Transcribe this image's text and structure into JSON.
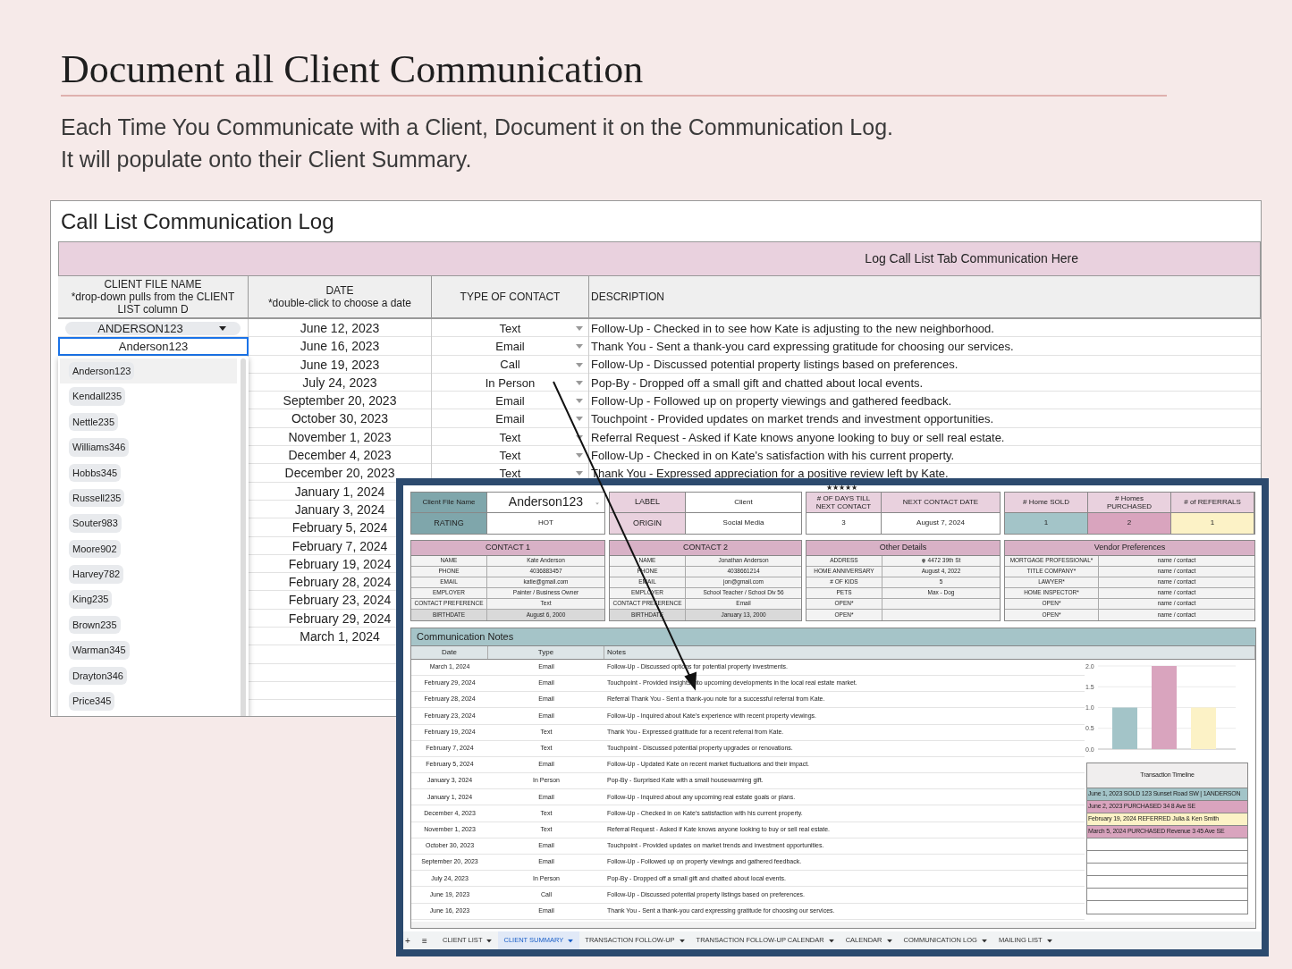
{
  "heading": {
    "title": "Document all Client Communication",
    "lines": [
      "Each Time You Communicate with a Client, Document it on the Communication Log.",
      "It will populate onto their Client Summary."
    ]
  },
  "log": {
    "title": "Call List Communication Log",
    "banner": "Log Call List Tab Communication Here",
    "columns": [
      {
        "title": "CLIENT FILE NAME",
        "note": "*drop-down pulls from the CLIENT LIST column D"
      },
      {
        "title": "DATE",
        "note": "*double-click to choose a date"
      },
      {
        "title": "TYPE OF CONTACT"
      },
      {
        "title": "DESCRIPTION"
      }
    ],
    "client_chip": "ANDERSON123",
    "client_editor": "Anderson123",
    "dropdown": [
      {
        "label": "Anderson123",
        "selected": true
      },
      {
        "label": "Kendall235",
        "selected": false
      },
      {
        "label": "Nettle235",
        "selected": false
      },
      {
        "label": "Williams346",
        "selected": false
      },
      {
        "label": "Hobbs345",
        "selected": false
      },
      {
        "label": "Russell235",
        "selected": false
      },
      {
        "label": "Souter983",
        "selected": false
      },
      {
        "label": "Moore902",
        "selected": false
      },
      {
        "label": "Harvey782",
        "selected": false
      },
      {
        "label": "King235",
        "selected": false
      },
      {
        "label": "Brown235",
        "selected": false
      },
      {
        "label": "Warman345",
        "selected": false
      },
      {
        "label": "Drayton346",
        "selected": false
      },
      {
        "label": "Price345",
        "selected": false
      }
    ],
    "rows": [
      {
        "date": "June 12, 2023",
        "type": "Text",
        "description": "Follow-Up - Checked in to see how Kate is adjusting to the new neighborhood."
      },
      {
        "date": "June 16, 2023",
        "type": "Email",
        "description": "Thank You - Sent a thank-you card expressing gratitude for choosing our services."
      },
      {
        "date": "June 19, 2023",
        "type": "Call",
        "description": "Follow-Up - Discussed potential property listings based on preferences."
      },
      {
        "date": "July 24, 2023",
        "type": "In Person",
        "description": "Pop-By - Dropped off a small gift and chatted about local events."
      },
      {
        "date": "September 20, 2023",
        "type": "Email",
        "description": "Follow-Up - Followed up on property viewings and gathered feedback."
      },
      {
        "date": "October 30, 2023",
        "type": "Email",
        "description": "Touchpoint - Provided updates on market trends and investment opportunities."
      },
      {
        "date": "November 1, 2023",
        "type": "Text",
        "description": "Referral Request - Asked if Kate knows anyone looking to buy or sell real estate."
      },
      {
        "date": "December 4, 2023",
        "type": "Text",
        "description": "Follow-Up - Checked in on Kate's satisfaction with his current property."
      },
      {
        "date": "December 20, 2023",
        "type": "Text",
        "description": "Thank You - Expressed appreciation for a positive review left by Kate."
      },
      {
        "date": "January 1, 2024"
      },
      {
        "date": "January 3, 2024"
      },
      {
        "date": "February 5, 2024"
      },
      {
        "date": "February 7, 2024"
      },
      {
        "date": "February 19, 2024"
      },
      {
        "date": "February 28, 2024"
      },
      {
        "date": "February 23, 2024"
      },
      {
        "date": "February 29, 2024"
      },
      {
        "date": "March 1, 2024"
      }
    ]
  },
  "summary": {
    "stars": "★★★★★",
    "client": {
      "label": "Client File Name",
      "value": "Anderson123",
      "rating_label": "RATING",
      "rating": "HOT"
    },
    "label_card": {
      "label": "LABEL",
      "value": "Client",
      "origin_label": "ORIGIN",
      "origin": "Social Media"
    },
    "contact_card": {
      "days_label": "# OF DAYS TILL NEXT CONTACT",
      "days": "3",
      "date_label": "NEXT CONTACT DATE",
      "date": "August 7, 2024"
    },
    "counts": [
      {
        "label": "# Home SOLD",
        "value": "1",
        "color": "#a3c4c8"
      },
      {
        "label": "# Homes PURCHASED",
        "value": "2",
        "color": "#d9a4be"
      },
      {
        "label": "# of REFERRALS",
        "value": "1",
        "color": "#fcf2c6"
      }
    ],
    "details": [
      {
        "title": "CONTACT 1",
        "rows": [
          {
            "label": "NAME",
            "value": "Kate Anderson"
          },
          {
            "label": "PHONE",
            "value": "4036883457"
          },
          {
            "label": "EMAIL",
            "value": "katie@gmail.com"
          },
          {
            "label": "EMPLOYER",
            "value": "Painter / Business Owner"
          },
          {
            "label": "CONTACT PREFERENCE",
            "value": "Text"
          },
          {
            "label": "BIRTHDATE",
            "value": "August 6, 2000"
          }
        ]
      },
      {
        "title": "CONTACT 2",
        "rows": [
          {
            "label": "NAME",
            "value": "Jonathan Anderson"
          },
          {
            "label": "PHONE",
            "value": "4038661214"
          },
          {
            "label": "EMAIL",
            "value": "jon@gmail.com"
          },
          {
            "label": "EMPLOYER",
            "value": "School Teacher / School Div 56"
          },
          {
            "label": "CONTACT PREFERENCE",
            "value": "Email"
          },
          {
            "label": "BIRTHDATE",
            "value": "January 13, 2000"
          }
        ]
      },
      {
        "title": "Other Details",
        "rows": [
          {
            "label": "ADDRESS",
            "value": "4472 39th St",
            "kind": "address"
          },
          {
            "label": "HOME ANNIVERSARY",
            "value": "August 4, 2022",
            "kind": "text"
          },
          {
            "label": "# OF KIDS",
            "value": "5",
            "kind": "text"
          },
          {
            "label": "PETS",
            "value": "Max - Dog",
            "kind": "text"
          },
          {
            "label": "OPEN*",
            "kind": "text"
          },
          {
            "label": "OPEN*",
            "kind": "text"
          }
        ]
      },
      {
        "title": "Vendor Preferences",
        "rows": [
          {
            "label": "MORTGAGE PROFESSIONAL*",
            "value": "name / contact"
          },
          {
            "label": "TITLE COMPANY*",
            "value": "name / contact"
          },
          {
            "label": "LAWYER*",
            "value": "name / contact"
          },
          {
            "label": "HOME INSPECTOR*",
            "value": "name / contact"
          },
          {
            "label": "OPEN*",
            "value": "name / contact"
          },
          {
            "label": "OPEN*",
            "value": "name / contact"
          }
        ]
      }
    ],
    "notes": {
      "title": "Communication Notes",
      "columns": [
        "Date",
        "Type",
        "Notes"
      ],
      "rows": [
        [
          "March 1, 2024",
          "Email",
          "Follow-Up - Discussed options for potential property investments."
        ],
        [
          "February 29, 2024",
          "Email",
          "Touchpoint - Provided insights into upcoming developments in the local real estate market."
        ],
        [
          "February 28, 2024",
          "Email",
          "Referral Thank You - Sent a thank-you note for a successful referral from Kate."
        ],
        [
          "February 23, 2024",
          "Email",
          "Follow-Up - Inquired about Kate's experience with recent property viewings."
        ],
        [
          "February 19, 2024",
          "Text",
          "Thank You - Expressed gratitude for a recent referral from Kate."
        ],
        [
          "February 7, 2024",
          "Text",
          "Touchpoint - Discussed potential property upgrades or renovations."
        ],
        [
          "February 5, 2024",
          "Email",
          "Follow-Up - Updated Kate on recent market fluctuations and their impact."
        ],
        [
          "January 3, 2024",
          "In Person",
          "Pop-By - Surprised Kate with a small housewarming gift."
        ],
        [
          "January 1, 2024",
          "Email",
          "Follow-Up - Inquired about any upcoming real estate goals or plans."
        ],
        [
          "December 4, 2023",
          "Text",
          "Follow-Up - Checked in on Kate's satisfaction with his current property."
        ],
        [
          "November 1, 2023",
          "Text",
          "Referral Request - Asked if Kate knows anyone looking to buy or sell real estate."
        ],
        [
          "October 30, 2023",
          "Email",
          "Touchpoint - Provided updates on market trends and investment opportunities."
        ],
        [
          "September 20, 2023",
          "Email",
          "Follow-Up - Followed up on property viewings and gathered feedback."
        ],
        [
          "July 24, 2023",
          "In Person",
          "Pop-By - Dropped off a small gift and chatted about local events."
        ],
        [
          "June 19, 2023",
          "Call",
          "Follow-Up - Discussed potential property listings based on preferences."
        ],
        [
          "June 16, 2023",
          "Email",
          "Thank You - Sent a thank-you card expressing gratitude for choosing our services."
        ]
      ],
      "chart_data": {
        "type": "bar",
        "grid": true,
        "ylim": [
          0,
          2
        ],
        "yticks": [
          {
            "value": 0,
            "label": "0.0"
          },
          {
            "value": 0.5,
            "label": "0.5"
          },
          {
            "value": 1,
            "label": "1.0"
          },
          {
            "value": 1.5,
            "label": "1.5"
          },
          {
            "value": 2,
            "label": "2.0"
          }
        ],
        "series": [
          {
            "color": "#a3c4c8",
            "values": [
              1
            ]
          },
          {
            "color": "#d9a4be",
            "values": [
              2
            ]
          },
          {
            "color": "#fcf2c6",
            "values": [
              1
            ]
          }
        ]
      },
      "timeline": {
        "title": "Transaction Timeline",
        "entries": [
          {
            "text": "June 1, 2023 SOLD 123 Sunset Road SW | 1ANDERSON",
            "color": "#a3c4c8"
          },
          {
            "text": "June 2, 2023 PURCHASED 34 8 Ave SE",
            "color": "#d9a4be"
          },
          {
            "text": "February 19, 2024 REFERRED Julia & Ken Smith",
            "color": "#fcf2c6"
          },
          {
            "text": "March 5, 2024 PURCHASED Revenue 3 45 Ave SE",
            "color": "#d9a4be"
          }
        ]
      }
    },
    "tabs": {
      "add": "+",
      "menu": "≡",
      "items": [
        {
          "label": "CLIENT LIST",
          "selected": false
        },
        {
          "label": "CLIENT SUMMARY",
          "selected": true
        },
        {
          "label": "TRANSACTION FOLLOW-UP",
          "selected": false
        },
        {
          "label": "TRANSACTION FOLLOW-UP CALENDAR",
          "selected": false
        },
        {
          "label": "CALENDAR",
          "selected": false
        },
        {
          "label": "COMMUNICATION LOG",
          "selected": false
        },
        {
          "label": "MAILING LIST",
          "selected": false
        }
      ]
    }
  }
}
